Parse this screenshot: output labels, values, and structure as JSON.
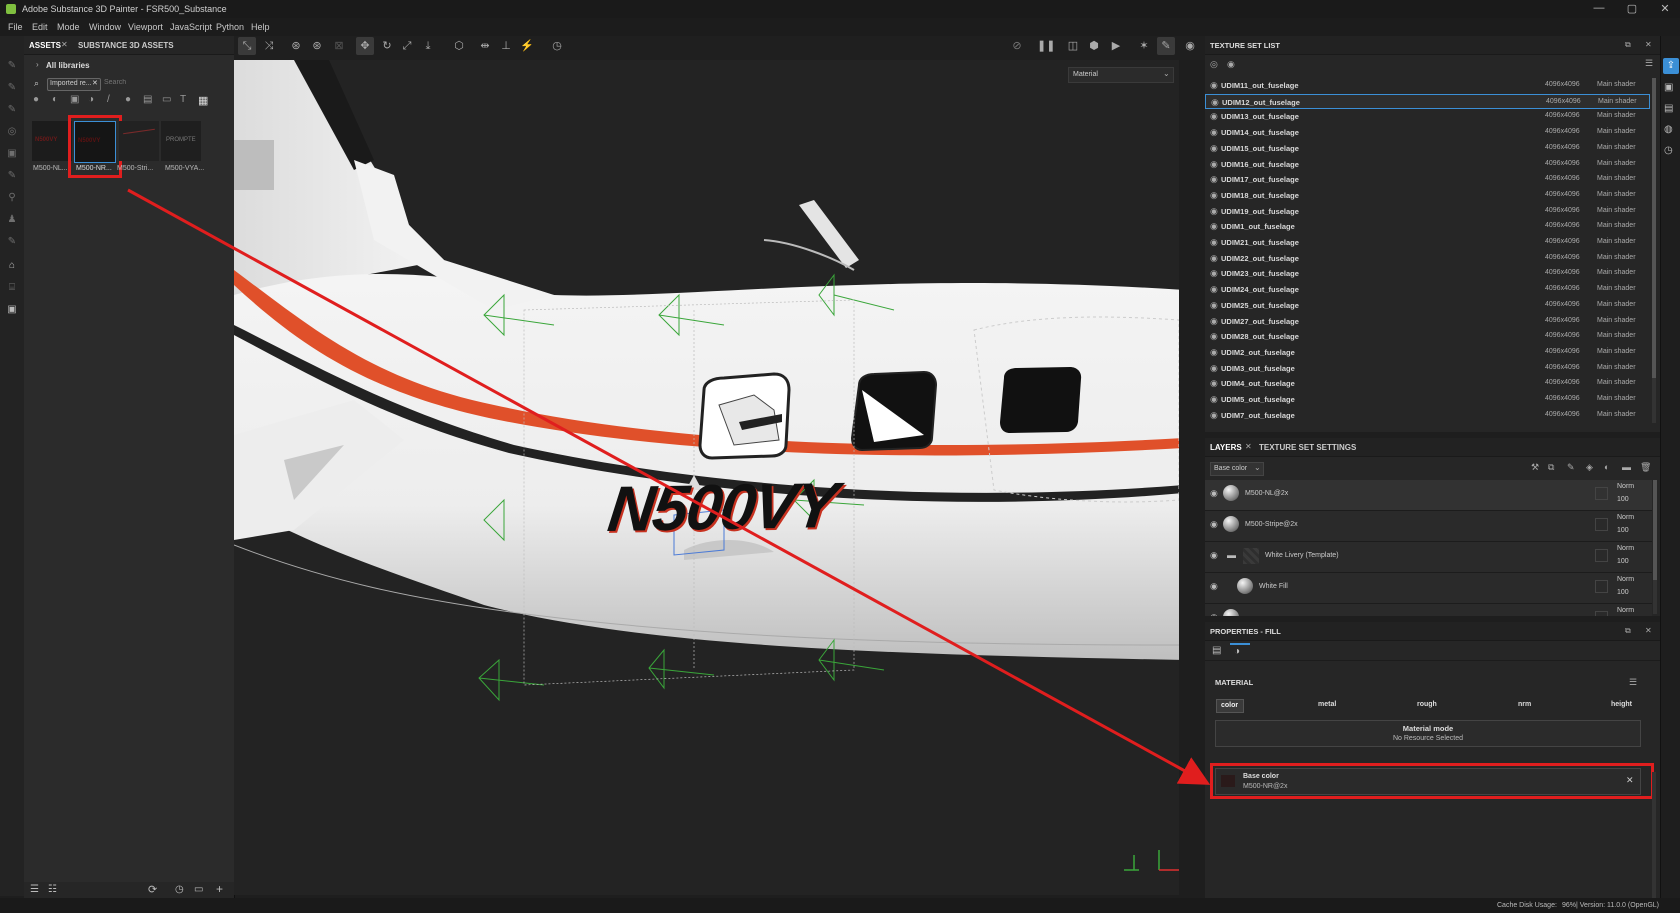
{
  "window": {
    "title": "Adobe Substance 3D Painter - FSR500_Substance"
  },
  "menu": [
    "File",
    "Edit",
    "Mode",
    "Window",
    "Viewport",
    "JavaScript",
    "Python",
    "Help"
  ],
  "assets_panel": {
    "tabs": [
      "ASSETS",
      "SUBSTANCE 3D ASSETS"
    ],
    "library": "All libraries",
    "filter_chip": "Imported re...",
    "search_placeholder": "Search",
    "thumbnails": [
      {
        "label": "M500-NL...",
        "thumb_text": "N500VY"
      },
      {
        "label": "M500-NR...",
        "thumb_text": "N500VY"
      },
      {
        "label": "M500-Stri...",
        "thumb_text": ""
      },
      {
        "label": "M500-VYA...",
        "thumb_text": "PROMPTE"
      }
    ]
  },
  "viewport": {
    "mode_select": "Material",
    "tail_number": "N500VY",
    "mode_button": "M"
  },
  "texture_set_list": {
    "title": "TEXTURE SET LIST",
    "rows": [
      {
        "name": "UDIM11_out_fuselage",
        "res": "4096x4096",
        "shader": "Main shader"
      },
      {
        "name": "UDIM12_out_fuselage",
        "res": "4096x4096",
        "shader": "Main shader"
      },
      {
        "name": "UDIM13_out_fuselage",
        "res": "4096x4096",
        "shader": "Main shader"
      },
      {
        "name": "UDIM14_out_fuselage",
        "res": "4096x4096",
        "shader": "Main shader"
      },
      {
        "name": "UDIM15_out_fuselage",
        "res": "4096x4096",
        "shader": "Main shader"
      },
      {
        "name": "UDIM16_out_fuselage",
        "res": "4096x4096",
        "shader": "Main shader"
      },
      {
        "name": "UDIM17_out_fuselage",
        "res": "4096x4096",
        "shader": "Main shader"
      },
      {
        "name": "UDIM18_out_fuselage",
        "res": "4096x4096",
        "shader": "Main shader"
      },
      {
        "name": "UDIM19_out_fuselage",
        "res": "4096x4096",
        "shader": "Main shader"
      },
      {
        "name": "UDIM1_out_fuselage",
        "res": "4096x4096",
        "shader": "Main shader"
      },
      {
        "name": "UDIM21_out_fuselage",
        "res": "4096x4096",
        "shader": "Main shader"
      },
      {
        "name": "UDIM22_out_fuselage",
        "res": "4096x4096",
        "shader": "Main shader"
      },
      {
        "name": "UDIM23_out_fuselage",
        "res": "4096x4096",
        "shader": "Main shader"
      },
      {
        "name": "UDIM24_out_fuselage",
        "res": "4096x4096",
        "shader": "Main shader"
      },
      {
        "name": "UDIM25_out_fuselage",
        "res": "4096x4096",
        "shader": "Main shader"
      },
      {
        "name": "UDIM27_out_fuselage",
        "res": "4096x4096",
        "shader": "Main shader"
      },
      {
        "name": "UDIM28_out_fuselage",
        "res": "4096x4096",
        "shader": "Main shader"
      },
      {
        "name": "UDIM2_out_fuselage",
        "res": "4096x4096",
        "shader": "Main shader"
      },
      {
        "name": "UDIM3_out_fuselage",
        "res": "4096x4096",
        "shader": "Main shader"
      },
      {
        "name": "UDIM4_out_fuselage",
        "res": "4096x4096",
        "shader": "Main shader"
      },
      {
        "name": "UDIM5_out_fuselage",
        "res": "4096x4096",
        "shader": "Main shader"
      },
      {
        "name": "UDIM7_out_fuselage",
        "res": "4096x4096",
        "shader": "Main shader"
      }
    ]
  },
  "layers_panel": {
    "tabs": [
      "LAYERS",
      "TEXTURE SET SETTINGS"
    ],
    "channel": "Base color",
    "layers": [
      {
        "name": "M500-NL@2x",
        "blend": "Norm",
        "opacity": "100"
      },
      {
        "name": "M500-Stripe@2x",
        "blend": "Norm",
        "opacity": "100"
      },
      {
        "name": "White Livery (Template)",
        "blend": "Norm",
        "opacity": "100"
      },
      {
        "name": "White Fill",
        "blend": "Norm",
        "opacity": "100"
      },
      {
        "name": "",
        "blend": "Norm",
        "opacity": ""
      }
    ]
  },
  "properties_panel": {
    "title": "PROPERTIES - FILL",
    "section": "MATERIAL",
    "channels": [
      "color",
      "metal",
      "rough",
      "nrm",
      "height"
    ],
    "material_mode_title": "Material mode",
    "material_mode_value": "No Resource Selected",
    "base_color_label": "Base color",
    "base_color_value": "M500-NR@2x"
  },
  "status": {
    "cache_label": "Cache Disk Usage:",
    "cache_value": "96%",
    "version": "| Version: 11.0.0 (OpenGL)"
  },
  "colors": {
    "accent": "#3b8fd6",
    "highlight": "#e01e1e",
    "stripe": "#e0502a"
  }
}
